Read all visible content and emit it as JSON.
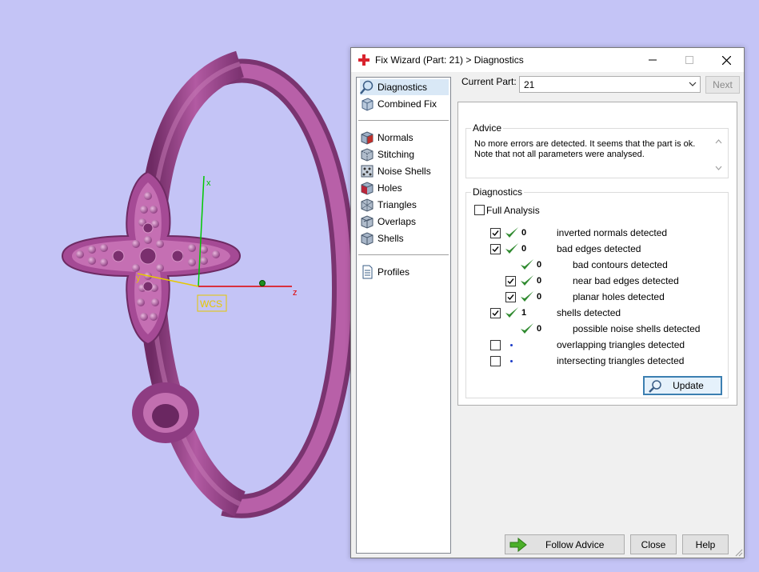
{
  "viewport": {
    "axis_x_label": "x",
    "axis_y_label": "y",
    "axis_z_label": "z",
    "wcs_label": "WCS"
  },
  "dialog": {
    "title": "Fix Wizard (Part: 21) > Diagnostics",
    "title_icon": "red-cross-icon",
    "current_part_label": "Current Part:",
    "current_part_value": "21",
    "next_label": "Next",
    "nav": [
      {
        "label": "Diagnostics",
        "icon": "magnifier-icon",
        "selected": true
      },
      {
        "label": "Combined Fix",
        "icon": "cube-icon"
      },
      {
        "label": "Normals",
        "icon": "normals-cube-icon"
      },
      {
        "label": "Stitching",
        "icon": "stitching-cube-icon"
      },
      {
        "label": "Noise Shells",
        "icon": "noise-shells-icon"
      },
      {
        "label": "Holes",
        "icon": "holes-cube-icon"
      },
      {
        "label": "Triangles",
        "icon": "triangles-cube-icon"
      },
      {
        "label": "Overlaps",
        "icon": "overlaps-cube-icon"
      },
      {
        "label": "Shells",
        "icon": "shells-cube-icon"
      },
      {
        "label": "Profiles",
        "icon": "document-icon"
      }
    ],
    "advice": {
      "title": "Advice",
      "line1": "No more errors are detected. It seems that the part is ok.",
      "line2": "Note that not all parameters were analysed."
    },
    "diagnostics": {
      "title": "Diagnostics",
      "full_analysis_label": "Full Analysis",
      "full_analysis_checked": false,
      "rows": [
        {
          "label": "inverted normals detected",
          "count": "0",
          "checked": true,
          "status": "ok"
        },
        {
          "label": "bad edges detected",
          "count": "0",
          "checked": true,
          "status": "ok"
        },
        {
          "label": "bad contours detected",
          "count": "0",
          "status": "ok"
        },
        {
          "label": "near bad edges detected",
          "count": "0",
          "checked": true,
          "status": "ok"
        },
        {
          "label": "planar holes detected",
          "count": "0",
          "checked": true,
          "status": "ok"
        },
        {
          "label": "shells detected",
          "count": "1",
          "checked": true,
          "status": "ok"
        },
        {
          "label": "possible noise shells detected",
          "count": "0",
          "status": "ok"
        },
        {
          "label": "overlapping triangles detected",
          "count": "",
          "checked": false,
          "status": "pending"
        },
        {
          "label": "intersecting triangles detected",
          "count": "",
          "checked": false,
          "status": "pending"
        }
      ],
      "update_label": "Update"
    },
    "buttons": {
      "follow_advice": "Follow Advice",
      "close": "Close",
      "help": "Help"
    }
  },
  "colors": {
    "background": "#c4c4f6",
    "ring": "#b0509e",
    "tick_green": "#2f8a2f",
    "axis_x": "#00c800",
    "axis_y": "#e6c800",
    "axis_z": "#e00000"
  }
}
